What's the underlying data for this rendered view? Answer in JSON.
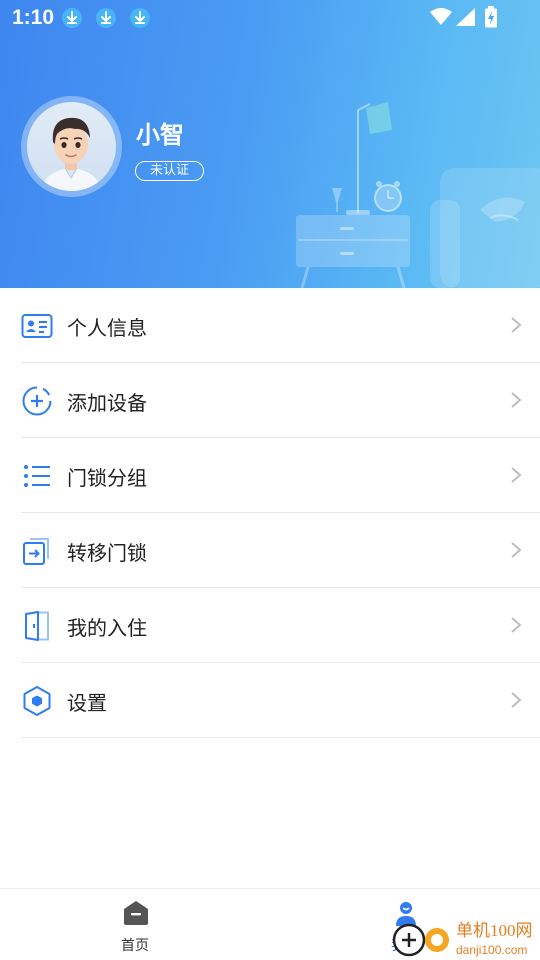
{
  "status_bar": {
    "time": "1:10"
  },
  "profile": {
    "name": "小智",
    "verification_status": "未认证"
  },
  "menu": {
    "items": [
      {
        "label": "个人信息",
        "icon": "id-card-icon"
      },
      {
        "label": "添加设备",
        "icon": "add-circle-icon"
      },
      {
        "label": "门锁分组",
        "icon": "list-icon"
      },
      {
        "label": "转移门锁",
        "icon": "transfer-icon"
      },
      {
        "label": "我的入住",
        "icon": "door-icon"
      },
      {
        "label": "设置",
        "icon": "settings-hexagon-icon"
      }
    ]
  },
  "tabbar": {
    "tabs": [
      {
        "label": "首页",
        "icon": "home-icon"
      },
      {
        "label": "我的",
        "icon": "person-icon",
        "active": true
      }
    ]
  },
  "watermark": {
    "brand": "单机100网",
    "url": "danji100.com"
  },
  "colors": {
    "header_gradient_start": "#3e86f0",
    "header_gradient_end": "#6cc6f2",
    "icon_blue": "#2f7cf0",
    "divider": "#e8e8e8"
  }
}
